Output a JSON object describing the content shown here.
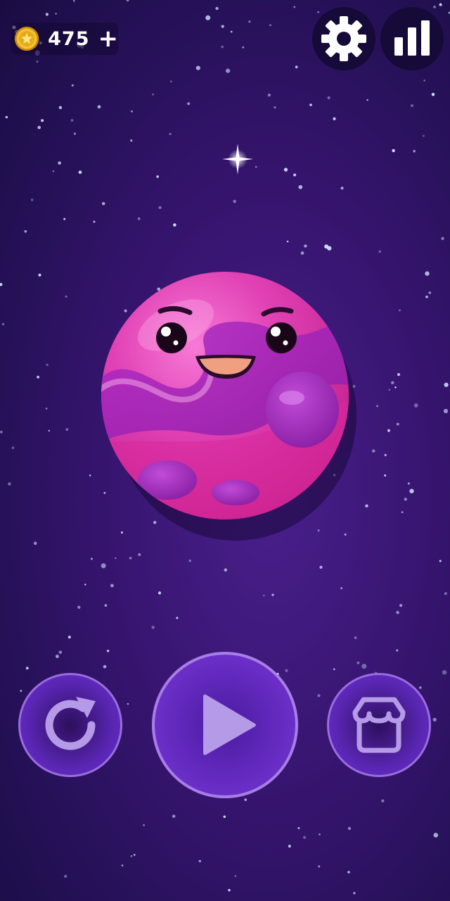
{
  "hud": {
    "coins": "475",
    "add_coins_symbol": "+",
    "icons": {
      "coin": "coin-icon",
      "settings": "gear-icon",
      "stats": "bar-chart-icon"
    }
  },
  "main": {
    "character": "smiling-pink-planet",
    "decoration": "sparkle-star-icon"
  },
  "controls": {
    "restart_icon": "restart-icon",
    "play_icon": "play-icon",
    "shop_icon": "shop-icon"
  },
  "colors": {
    "background": "#35146d",
    "planet": "#e041b4",
    "planet_dark": "#b22488",
    "button_fill": "#6b2fc8",
    "button_border": "#a77de6",
    "icon_light": "#b59ae8",
    "coin": "#f2c230"
  }
}
